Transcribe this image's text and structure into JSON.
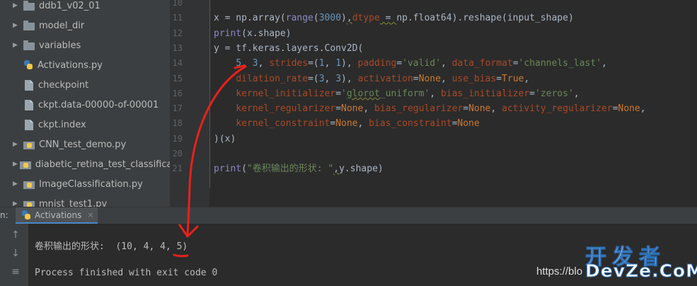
{
  "project_tree": [
    {
      "label": "ddb1_v02_01",
      "type": "folder",
      "expandable": true
    },
    {
      "label": "model_dir",
      "type": "folder",
      "expandable": true
    },
    {
      "label": "variables",
      "type": "folder",
      "expandable": true
    },
    {
      "label": "Activations.py",
      "type": "python-file",
      "expandable": false
    },
    {
      "label": "checkpoint",
      "type": "file",
      "expandable": false
    },
    {
      "label": "ckpt.data-00000-of-00001",
      "type": "file",
      "expandable": false
    },
    {
      "label": "ckpt.index",
      "type": "file",
      "expandable": false
    },
    {
      "label": "CNN_test_demo.py",
      "type": "python-folder",
      "expandable": true
    },
    {
      "label": "diabetic_retina_test_classification",
      "type": "python-folder",
      "expandable": true
    },
    {
      "label": "ImageClassification.py",
      "type": "python-folder",
      "expandable": true
    },
    {
      "label": "mnist_test1.py",
      "type": "python-folder",
      "expandable": true
    }
  ],
  "editor": {
    "line_numbers": [
      "10",
      "11",
      "12",
      "13",
      "14",
      "15",
      "16",
      "17",
      "18",
      "19",
      "20",
      "21"
    ],
    "lines": [
      {
        "num": "10",
        "html": ""
      },
      {
        "num": "11",
        "html": "x = np.array(<span class=\"builtin\">range</span>(<span class=\"num\">3000</span>)<span class=\"squig\">,</span><span class=\"kwarg\">dtype</span><span class=\"squig\"> = </span>np.float64).reshape(input_shape)"
      },
      {
        "num": "12",
        "html": "<span class=\"builtin\">print</span>(x.shape)"
      },
      {
        "num": "13",
        "html": "y = tf.keras.layers.Conv2D("
      },
      {
        "num": "14",
        "html": "    <span class=\"num\">5</span>, <span class=\"num\">3</span>, <span class=\"kwarg\">strides</span>=(<span class=\"num\">1</span>, <span class=\"num\">1</span>), <span class=\"kwarg\">padding</span>=<span class=\"str\">'valid'</span>, <span class=\"kwarg\">data_format</span>=<span class=\"str\">'channels_last'</span>,"
      },
      {
        "num": "15",
        "html": "    <span class=\"kwarg\">dilation_rate</span>=(<span class=\"num\">3</span>, <span class=\"num\">3</span>), <span class=\"kwarg\">activation</span>=<span class=\"kw\">None</span>, <span class=\"kwarg\">use_bias</span>=<span class=\"kw\">True</span>,"
      },
      {
        "num": "16",
        "html": "    <span class=\"kwarg\">kernel_initializer</span>=<span class=\"str\">'<span class=\"squig\">glorot</span>_uniform'</span>, <span class=\"kwarg\">bias_initializer</span>=<span class=\"str\">'zeros'</span>,"
      },
      {
        "num": "17",
        "html": "    <span class=\"kwarg\">kernel_regularizer</span>=<span class=\"kw\">None</span>, <span class=\"kwarg\">bias_regularizer</span>=<span class=\"kw\">None</span>, <span class=\"kwarg\">activity_regularizer</span>=<span class=\"kw\">None</span>,"
      },
      {
        "num": "18",
        "html": "    <span class=\"kwarg\">kernel_constraint</span>=<span class=\"kw\">None</span>, <span class=\"kwarg\">bias_constraint</span>=<span class=\"kw\">None</span>"
      },
      {
        "num": "19",
        "html": ")(x)"
      },
      {
        "num": "20",
        "html": ""
      },
      {
        "num": "21",
        "html": "<span class=\"builtin\">print</span>(<span class=\"str\">\"卷积输出的形状: \"</span><span class=\"squig\">,</span>y.shape)"
      }
    ]
  },
  "run_panel": {
    "label": "n:",
    "tab_title": "Activations",
    "tab_close": "×",
    "toolbar_icons": [
      "arrow-up-icon",
      "arrow-down-icon",
      "wrap-lines-icon"
    ],
    "console_output_line": "卷积输出的形状:  (10, 4, 4, 5)",
    "console_exit_line": "Process finished with exit code 0"
  },
  "watermark": {
    "url_text": "https://blo",
    "logo_cn": "开发者",
    "logo_en": "DevZe.CoM"
  },
  "colors": {
    "annotation_red": "#e8211b",
    "tab_underline": "#4a88c7"
  }
}
